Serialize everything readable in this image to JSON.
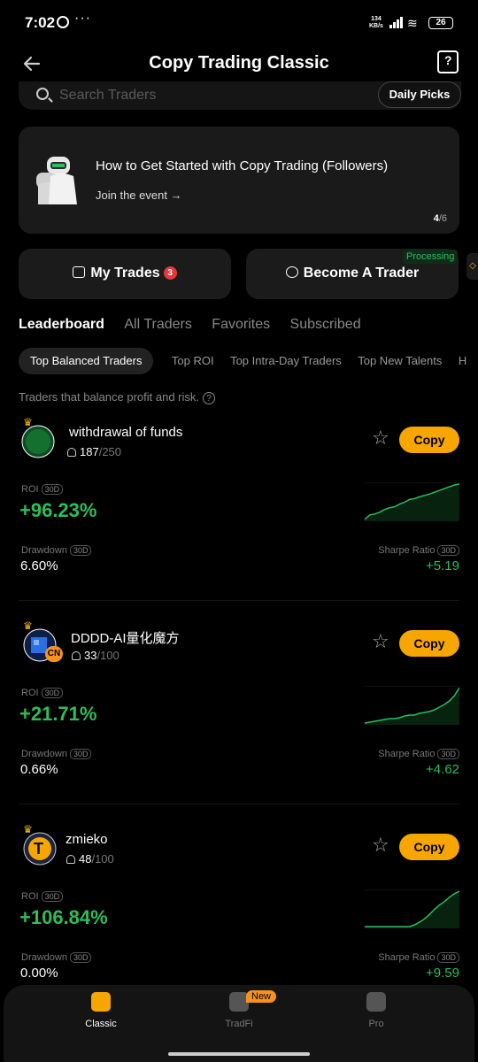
{
  "status": {
    "time": "7:02",
    "dots": "···",
    "net_speed": "134",
    "net_unit": "KB/s",
    "battery": "26"
  },
  "header": {
    "title": "Copy Trading Classic"
  },
  "search": {
    "placeholder": "Search Traders",
    "daily_picks": "Daily Picks"
  },
  "banner": {
    "title": "How to Get Started with Copy Trading (Followers)",
    "link": "Join the event →",
    "page_current": "4",
    "page_total": "/6"
  },
  "actions": {
    "my_trades": "My Trades",
    "my_trades_badge": "3",
    "become": "Become A Trader",
    "processing": "Processing"
  },
  "tabs": [
    "Leaderboard",
    "All Traders",
    "Favorites",
    "Subscribed"
  ],
  "chips": [
    "Top Balanced Traders",
    "Top ROI",
    "Top Intra-Day Traders",
    "Top New Talents",
    "H"
  ],
  "description": "Traders that balance profit and risk.",
  "period": "30D",
  "labels": {
    "roi": "ROI",
    "drawdown": "Drawdown",
    "sharpe": "Sharpe Ratio",
    "copy": "Copy"
  },
  "traders": [
    {
      "name": "withdrawal of funds",
      "followers": "187",
      "max": "/250",
      "roi": "+96.23%",
      "drawdown": "6.60%",
      "sharpe": "+5.19",
      "trend": [
        2,
        12,
        14,
        18,
        24,
        28,
        30,
        36,
        40,
        46,
        48,
        52,
        55,
        58,
        62,
        66,
        70,
        74,
        78,
        80
      ]
    },
    {
      "name": "DDDD-AI量化魔方",
      "followers": "33",
      "max": "/100",
      "roi": "+21.71%",
      "drawdown": "0.66%",
      "sharpe": "+4.62",
      "badge": "CN",
      "trend": [
        4,
        6,
        8,
        10,
        12,
        14,
        14,
        16,
        20,
        22,
        22,
        26,
        28,
        30,
        34,
        40,
        46,
        54,
        66,
        84
      ]
    },
    {
      "name": "zmieko",
      "followers": "48",
      "max": "/100",
      "roi": "+106.84%",
      "drawdown": "0.00%",
      "sharpe": "+9.59",
      "avatar_letter": "T",
      "trend": [
        0,
        0,
        0,
        0,
        0,
        0,
        0,
        0,
        0,
        0,
        4,
        10,
        18,
        28,
        40,
        50,
        58,
        68,
        76,
        82
      ]
    }
  ],
  "nav": {
    "classic": "Classic",
    "tradfi": "TradFi",
    "pro": "Pro",
    "new_badge": "New"
  },
  "colors": {
    "accent": "#f7a600",
    "positive": "#2ebd59",
    "background": "#000000"
  }
}
